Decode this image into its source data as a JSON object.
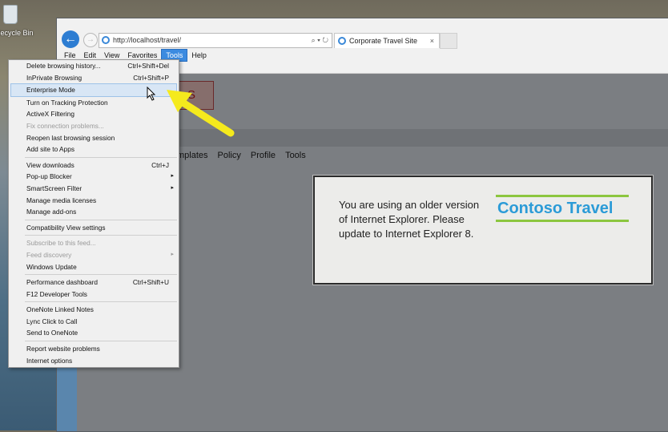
{
  "desktop": {
    "recycle_bin_label": "Recycle Bin"
  },
  "browser": {
    "address_url": "http://localhost/travel/",
    "address_tools": "⌕ ▾ ↻",
    "tab_title": "Corporate Travel Site",
    "tab_close": "×",
    "back_glyph": "←",
    "forward_glyph": "→",
    "menubar": [
      "File",
      "Edit",
      "View",
      "Favorites",
      "Tools",
      "Help"
    ]
  },
  "page": {
    "logo_fragment": "S",
    "nav": [
      "mplates",
      "Policy",
      "Profile",
      "Tools"
    ],
    "notice": {
      "message": "You are using an older version of Internet Explorer. Please update to Internet Explorer 8.",
      "brand": "Contoso Travel",
      "brand_color": "#2b9bd7",
      "brand_bar_color": "#8cc63f"
    }
  },
  "tools_menu": {
    "items": [
      {
        "label": "Delete browsing history...",
        "shortcut": "Ctrl+Shift+Del"
      },
      {
        "label": "InPrivate Browsing",
        "shortcut": "Ctrl+Shift+P"
      },
      {
        "label": "Enterprise Mode",
        "highlighted": true
      },
      {
        "label": "Turn on Tracking Protection"
      },
      {
        "label": "ActiveX Filtering"
      },
      {
        "label": "Fix connection problems...",
        "disabled": true
      },
      {
        "label": "Reopen last browsing session"
      },
      {
        "label": "Add site to Apps"
      },
      {
        "separator": true
      },
      {
        "label": "View downloads",
        "shortcut": "Ctrl+J"
      },
      {
        "label": "Pop-up Blocker",
        "submenu": true
      },
      {
        "label": "SmartScreen Filter",
        "submenu": true
      },
      {
        "label": "Manage media licenses"
      },
      {
        "label": "Manage add-ons"
      },
      {
        "separator": true
      },
      {
        "label": "Compatibility View settings"
      },
      {
        "separator": true
      },
      {
        "label": "Subscribe to this feed...",
        "disabled": true
      },
      {
        "label": "Feed discovery",
        "disabled": true,
        "submenu": true
      },
      {
        "label": "Windows Update"
      },
      {
        "separator": true
      },
      {
        "label": "Performance dashboard",
        "shortcut": "Ctrl+Shift+U"
      },
      {
        "label": "F12 Developer Tools"
      },
      {
        "separator": true
      },
      {
        "label": "OneNote Linked Notes"
      },
      {
        "label": "Lync Click to Call"
      },
      {
        "label": "Send to OneNote"
      },
      {
        "separator": true
      },
      {
        "label": "Report website problems"
      },
      {
        "label": "Internet options"
      }
    ]
  },
  "annotation": {
    "arrow_color": "#f5ea1d"
  }
}
